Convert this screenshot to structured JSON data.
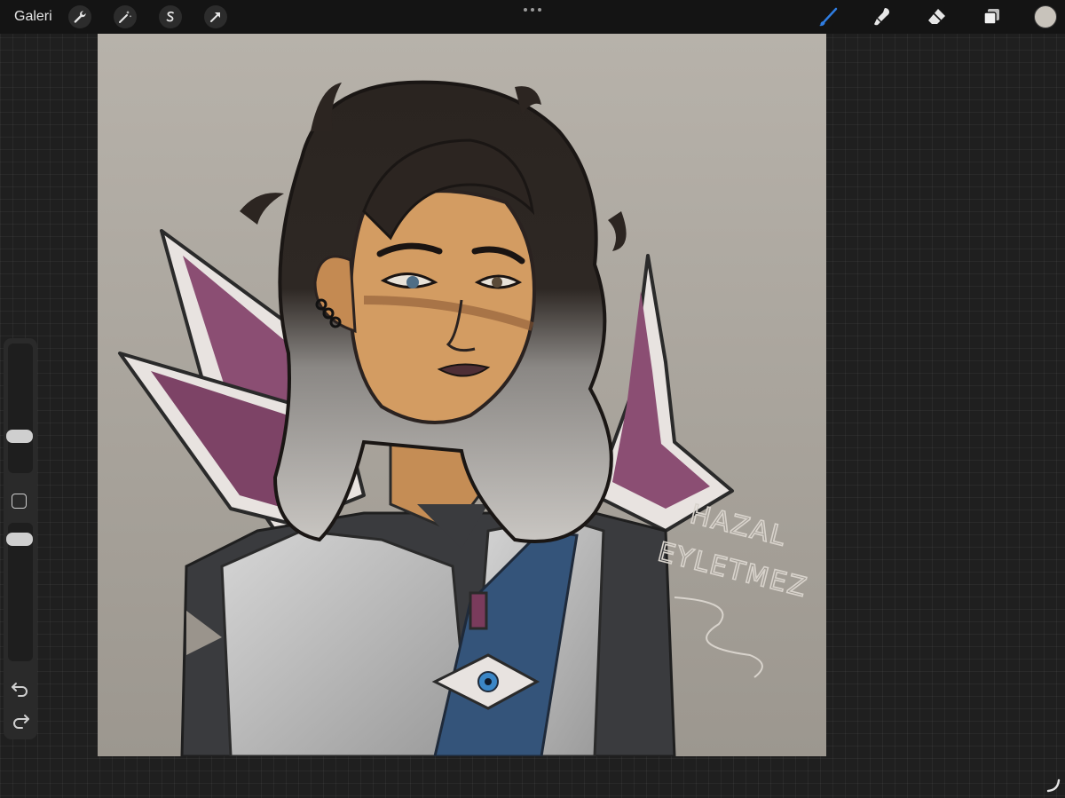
{
  "toolbar": {
    "gallery_label": "Galeri",
    "left_tools": [
      "wrench-icon",
      "magic-wand-icon",
      "selection-icon",
      "transform-arrow-icon"
    ],
    "right_tools": [
      "brush-icon",
      "smudge-icon",
      "eraser-icon",
      "layers-icon"
    ],
    "active_tool": "brush",
    "active_color": "#c8c3bb",
    "accent_color": "#2f7de1"
  },
  "canvas": {
    "artwork": "character-portrait",
    "signature": "HAZAL EYLETMEZ",
    "signature_line1": "HAZAL",
    "signature_line2": "EYLETMEZ"
  },
  "sidebar": {
    "brush_size": 0.26,
    "opacity": 0.92,
    "undo_icon": "undo-icon",
    "redo_icon": "redo-icon"
  }
}
